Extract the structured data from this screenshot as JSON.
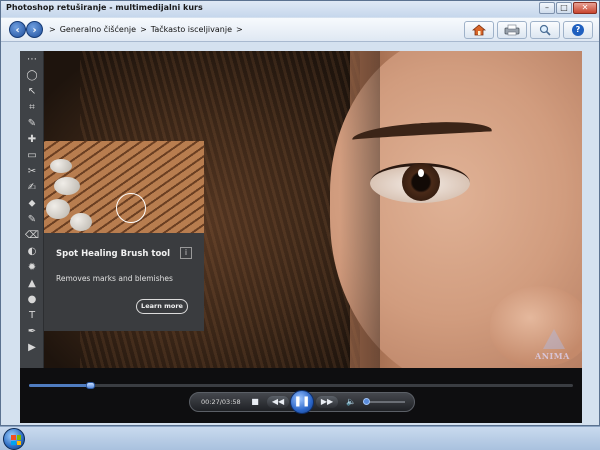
{
  "window": {
    "title": "Photoshop retuširanje - multimedijalni kurs",
    "buttons": {
      "minimize": "–",
      "maximize": "□",
      "close": "✕"
    }
  },
  "nav": {
    "back_icon": "back-arrow-icon",
    "forward_icon": "forward-arrow-icon",
    "breadcrumb": [
      "Generalno čišćenje",
      "Tačkasto isceljivanje"
    ],
    "separator": ">",
    "toolbar_icons": [
      "home-icon",
      "print-icon",
      "search-icon",
      "help-icon"
    ],
    "help_label": "?"
  },
  "video": {
    "tools": [
      "⋯",
      "◯",
      "↖",
      "⌗",
      "✎",
      "✚",
      "▭",
      "✂",
      "✍",
      "⬥",
      "✎",
      "⌫",
      "◐",
      "✹",
      "▲",
      "●",
      "T",
      "✒",
      "▶"
    ],
    "tooltip": {
      "title": "Spot Healing Brush tool",
      "info": "i",
      "description": "Removes marks and blemishes",
      "learn_more": "Learn more"
    },
    "watermark": "ANIMA"
  },
  "player": {
    "time_display": "00:27/03:58",
    "progress_fraction": 0.113,
    "volume_fraction": 0.0,
    "stop": "■",
    "rewind": "◀◀",
    "play_pause": "❚❚",
    "fast_forward": "▶▶",
    "volume_icon": "🔈"
  },
  "taskbar": {
    "start_icon": "windows-start-icon",
    "colors": {
      "red": "#f25022",
      "green": "#7fba00",
      "blue": "#00a4ef",
      "yellow": "#ffb900"
    }
  }
}
